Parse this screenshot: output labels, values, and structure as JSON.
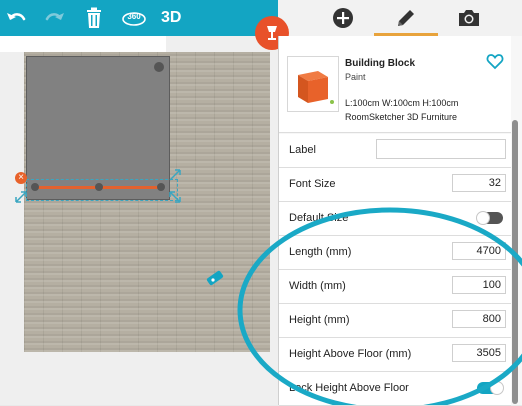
{
  "toolbar": {
    "undo_icon": "undo-icon",
    "redo_icon": "redo-icon",
    "delete_icon": "trash-icon",
    "view360_label": "360",
    "view3d_label": "3D"
  },
  "tabs": {
    "add_icon": "plus-circle-icon",
    "edit_icon": "pencil-icon",
    "camera_icon": "camera-icon",
    "active": "edit"
  },
  "item": {
    "name": "Building Block",
    "material": "Paint",
    "dimensions": "L:100cm W:100cm H:100cm",
    "source": "RoomSketcher 3D Furniture"
  },
  "properties": {
    "label": {
      "label": "Label",
      "value": ""
    },
    "font_size": {
      "label": "Font Size",
      "value": "32"
    },
    "default_size": {
      "label": "Default Size",
      "on": false
    },
    "length": {
      "label": "Length (mm)",
      "value": "4700"
    },
    "width": {
      "label": "Width (mm)",
      "value": "100"
    },
    "height": {
      "label": "Height (mm)",
      "value": "800"
    },
    "height_above_floor": {
      "label": "Height Above Floor (mm)",
      "value": "3505"
    },
    "lock_height": {
      "label": "Lock Height Above Floor",
      "on": true
    }
  },
  "colors": {
    "toolbar": "#13a5c3",
    "accent_orange": "#e8512a",
    "tab_underline": "#e8a33c",
    "toggle_on": "#13a5c3",
    "highlight_ring": "#1aa9c6"
  }
}
